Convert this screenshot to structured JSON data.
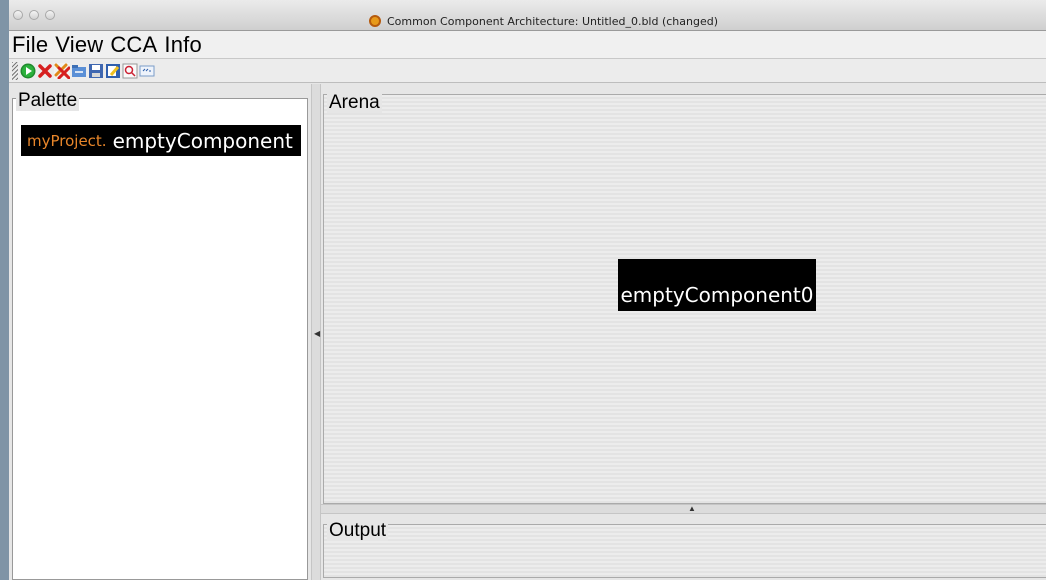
{
  "window": {
    "title": "Common Component Architecture: Untitled_0.bld (changed)"
  },
  "menubar": {
    "items": [
      "File",
      "View",
      "CCA",
      "Info"
    ]
  },
  "toolbar": {
    "icons": [
      "run-icon",
      "delete-icon",
      "delete-all-icon",
      "open-icon",
      "save-icon",
      "edit-icon",
      "find-icon",
      "log-icon"
    ]
  },
  "palette": {
    "label": "Palette",
    "items": [
      {
        "package": "myProject.",
        "component": "emptyComponent"
      }
    ]
  },
  "arena": {
    "label": "Arena",
    "components": [
      {
        "name": "emptyComponent0"
      }
    ]
  },
  "output": {
    "label": "Output"
  },
  "colors": {
    "package_text": "#e8862a",
    "component_bg": "#000000",
    "component_text": "#ffffff"
  }
}
